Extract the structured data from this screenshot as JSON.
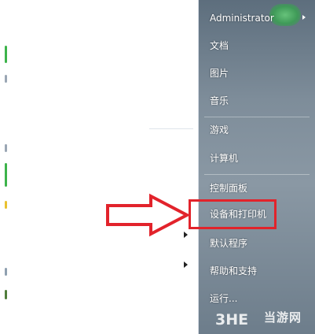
{
  "menu": {
    "user": "Administrator",
    "items": [
      {
        "label": "文档"
      },
      {
        "label": "图片"
      },
      {
        "label": "音乐"
      },
      {
        "label": "游戏"
      },
      {
        "label": "计算机"
      },
      {
        "label": "控制面板"
      },
      {
        "label": "设备和打印机"
      },
      {
        "label": "默认程序"
      },
      {
        "label": "帮助和支持"
      },
      {
        "label": "运行..."
      }
    ]
  },
  "watermark": {
    "logo_text": "3HE",
    "text": "当游网"
  },
  "colors": {
    "highlight": "#e2232b",
    "panel": "#7e8d9a"
  },
  "icons": [
    "submenu-arrow-icon",
    "red-callout-arrow-icon",
    "user-avatar-icon"
  ]
}
